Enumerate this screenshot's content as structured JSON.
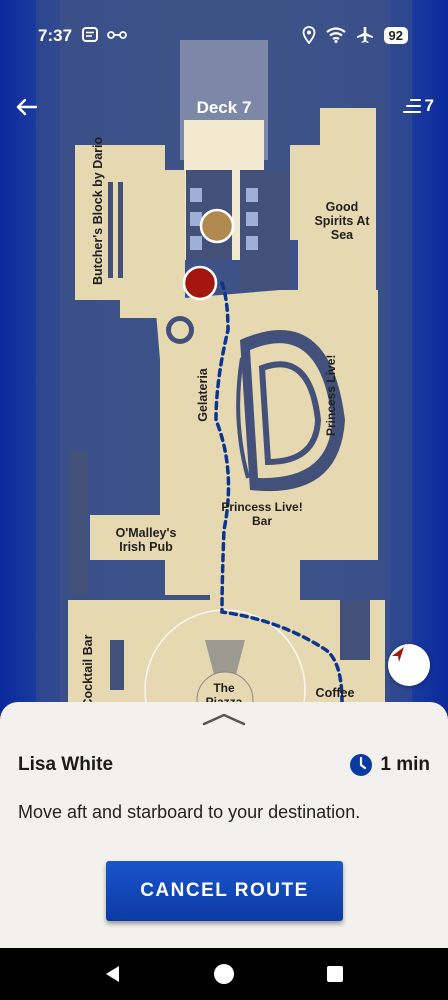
{
  "status_bar": {
    "time": "7:37",
    "battery": "92",
    "icons": [
      "message-icon",
      "link-icon",
      "location-icon",
      "wifi-icon",
      "airplane-icon"
    ]
  },
  "header": {
    "title": "Deck 7",
    "deck_number": "7",
    "icons": [
      "arrow-left-icon",
      "deck-layers-icon"
    ]
  },
  "map": {
    "labels": {
      "butchers_block": "Butcher's Block by Dario",
      "good_spirits": "Good Spirits At Sea",
      "gelateria": "Gelateria",
      "princess_live": "Princess Live!",
      "princess_live_bar": "Princess Live! Bar",
      "omalleys": "O'Malley's Irish Pub",
      "cocktail_bar": "Cocktail Bar",
      "the_piazza": "The Piazza",
      "coffee": "Coffee"
    },
    "markers": {
      "destination_color": "#b08a4e",
      "current_location_color": "#a3160e",
      "route_color": "#0a3591"
    }
  },
  "sheet": {
    "name": "Lisa White",
    "eta": "1 min",
    "instruction": "Move aft and starboard to your destination.",
    "cancel_label": "CANCEL ROUTE"
  },
  "colors": {
    "accent": "#0b3aa3",
    "map_floor": "#e6d8b0",
    "sheet_bg": "#f3f1ee"
  }
}
